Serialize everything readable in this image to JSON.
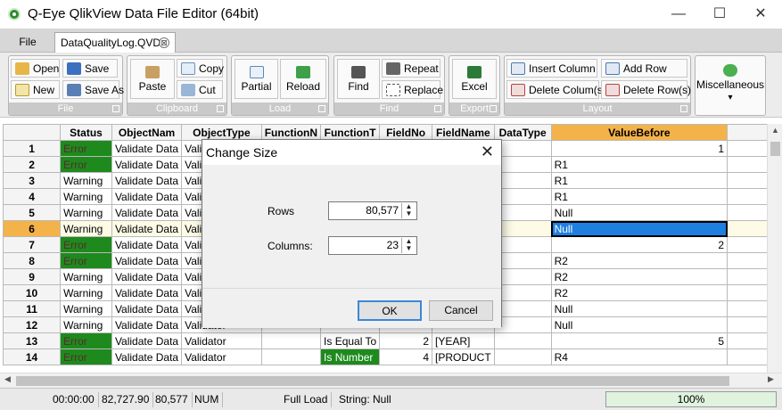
{
  "window": {
    "title": "Q-Eye QlikView Data File Editor (64bit)",
    "minimize_glyph": "—",
    "maximize_glyph": "☐",
    "close_glyph": "✕"
  },
  "menubar": {
    "file_label": "File",
    "doc_tab_label": "DataQualityLog.QVD",
    "doc_tab_close_glyph": "⊠"
  },
  "ribbon": {
    "groups": {
      "file": "File",
      "clipboard": "Clipboard",
      "load": "Load",
      "find": "Find",
      "export": "Export",
      "layout": "Layout"
    },
    "buttons": {
      "open": "Open",
      "new": "New",
      "save": "Save",
      "save_as": "Save As",
      "paste": "Paste",
      "copy": "Copy",
      "cut": "Cut",
      "partial": "Partial",
      "reload": "Reload",
      "find": "Find",
      "repeat": "Repeat",
      "replace": "Replace",
      "excel": "Excel",
      "insert_column": "Insert Column",
      "delete_columns": "Delete Colum(s)",
      "add_row": "Add Row",
      "delete_rows": "Delete Row(s)",
      "miscellaneous": "Miscellaneous",
      "misc_arrow": "▾"
    },
    "icons": [
      "open-folder-icon",
      "new-document-icon",
      "save-disk-icon",
      "save-as-icon",
      "paste-icon",
      "copy-icon",
      "cut-scissors-icon",
      "partial-load-icon",
      "reload-icon",
      "binoculars-icon",
      "repeat-find-icon",
      "replace-icon",
      "excel-icon",
      "insert-column-icon",
      "delete-column-icon",
      "add-row-icon",
      "delete-row-icon",
      "miscellaneous-icon"
    ]
  },
  "grid": {
    "columns": [
      "Status",
      "ObjectNam",
      "ObjectType",
      "FunctionN",
      "FunctionT",
      "FieldNo",
      "FieldName",
      "DataType",
      "ValueBefore"
    ],
    "rows": [
      {
        "n": "1",
        "status": "Error",
        "obj": "Validate Data",
        "type": "Valida",
        "fn": "",
        "ft": "",
        "no": "",
        "field": "",
        "dt": "",
        "vb": "1"
      },
      {
        "n": "2",
        "status": "Error",
        "obj": "Validate Data",
        "type": "Valida",
        "fn": "",
        "ft": "",
        "no": "",
        "field": "",
        "dt": "",
        "vb": "R1"
      },
      {
        "n": "3",
        "status": "Warning",
        "obj": "Validate Data",
        "type": "Valida",
        "fn": "",
        "ft": "",
        "no": "",
        "field": "",
        "dt": "",
        "vb": "R1"
      },
      {
        "n": "4",
        "status": "Warning",
        "obj": "Validate Data",
        "type": "Valida",
        "fn": "",
        "ft": "",
        "no": "",
        "field": "",
        "dt": "",
        "vb": "R1"
      },
      {
        "n": "5",
        "status": "Warning",
        "obj": "Validate Data",
        "type": "Valida",
        "fn": "",
        "ft": "",
        "no": "",
        "field": "",
        "dt": "",
        "vb": "Null"
      },
      {
        "n": "6",
        "status": "Warning",
        "obj": "Validate Data",
        "type": "Valida",
        "fn": "",
        "ft": "",
        "no": "",
        "field": "",
        "dt": "",
        "vb": "Null"
      },
      {
        "n": "7",
        "status": "Error",
        "obj": "Validate Data",
        "type": "Valida",
        "fn": "",
        "ft": "",
        "no": "",
        "field": "",
        "dt": "",
        "vb": "2"
      },
      {
        "n": "8",
        "status": "Error",
        "obj": "Validate Data",
        "type": "Valida",
        "fn": "",
        "ft": "",
        "no": "",
        "field": "",
        "dt": "",
        "vb": "R2"
      },
      {
        "n": "9",
        "status": "Warning",
        "obj": "Validate Data",
        "type": "Valida",
        "fn": "",
        "ft": "",
        "no": "",
        "field": "",
        "dt": "",
        "vb": "R2"
      },
      {
        "n": "10",
        "status": "Warning",
        "obj": "Validate Data",
        "type": "Valida",
        "fn": "",
        "ft": "",
        "no": "",
        "field": "",
        "dt": "",
        "vb": "R2"
      },
      {
        "n": "11",
        "status": "Warning",
        "obj": "Validate Data",
        "type": "Valida",
        "fn": "",
        "ft": "",
        "no": "",
        "field": "",
        "dt": "",
        "vb": "Null"
      },
      {
        "n": "12",
        "status": "Warning",
        "obj": "Validate Data",
        "type": "Validator",
        "fn": "",
        "ft": "",
        "no": "",
        "field": "",
        "dt": "",
        "vb": "Null"
      },
      {
        "n": "13",
        "status": "Error",
        "obj": "Validate Data",
        "type": "Validator",
        "fn": "",
        "ft": "Is Equal To",
        "no": "2",
        "field": "[YEAR]",
        "dt": "",
        "vb": "5"
      },
      {
        "n": "14",
        "status": "Error",
        "obj": "Validate Data",
        "type": "Validator",
        "fn": "",
        "ft": "Is Number",
        "no": "4",
        "field": "[PRODUCT",
        "dt": "",
        "vb": "R4"
      }
    ],
    "selected_row": "6"
  },
  "statusbar": {
    "time": "00:00:00",
    "value": "82,727.90",
    "rows": "80,577",
    "num": "NUM",
    "load": "Full Load",
    "string": "String: Null",
    "progress": "100%",
    "progress_fraction": 1.0
  },
  "dialog": {
    "title": "Change Size",
    "close_glyph": "✕",
    "rows_label": "Rows",
    "rows_value": "80,577",
    "columns_label": "Columns:",
    "columns_value": "23",
    "ok_label": "OK",
    "cancel_label": "Cancel"
  },
  "colors": {
    "error_green": "#1e8a1e",
    "header_orange": "#f4b34a",
    "selection_blue": "#1e7fe0",
    "app_icon_green": "#2e8b2e"
  }
}
